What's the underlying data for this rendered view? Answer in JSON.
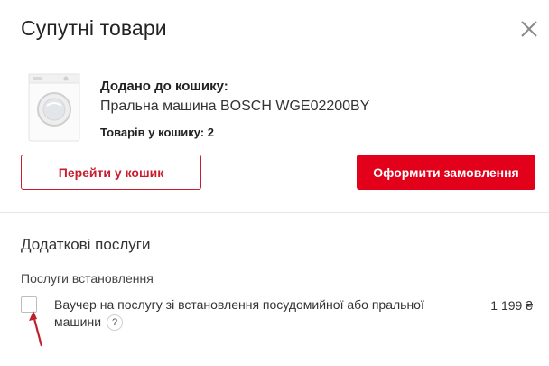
{
  "modal": {
    "title": "Супутні товари"
  },
  "cart": {
    "added_label": "Додано до кошику:",
    "product_name": "Пральна машина BOSCH WGE02200BY",
    "count_text": "Товарів у кошику: 2"
  },
  "actions": {
    "go_to_cart": "Перейти у кошик",
    "checkout": "Оформити замовлення"
  },
  "services": {
    "title": "Додаткові послуги",
    "group_title": "Послуги встановлення",
    "items": [
      {
        "label": "Ваучер на послугу зі встановлення посудомийної або пральної машини",
        "help": "?",
        "price": "1 199 ₴",
        "checked": false
      }
    ]
  },
  "colors": {
    "accent": "#e2001a",
    "accent_border": "#c81d2e",
    "annotation_arrow": "#c0202e"
  },
  "icons": [
    "close-icon",
    "washing-machine-image",
    "help-icon",
    "annotation-arrow"
  ]
}
